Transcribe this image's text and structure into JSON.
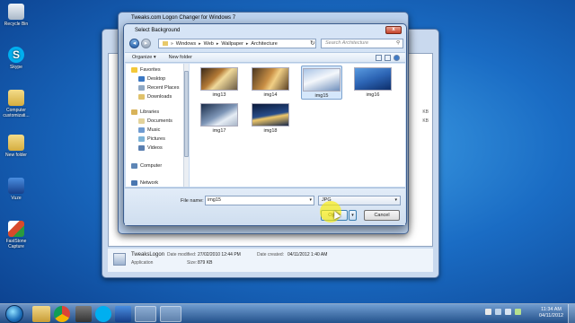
{
  "desktop": {
    "icons": [
      {
        "label": "Recycle Bin",
        "icon": "recycle-bin-icon",
        "color": "#cfd8e2"
      },
      {
        "label": "Skype",
        "icon": "skype-icon",
        "color": "#00aff0"
      },
      {
        "label": "Computer customizati...",
        "icon": "folder-icon",
        "color": "#e8c96a"
      },
      {
        "label": "New folder",
        "icon": "folder-icon",
        "color": "#e8c96a"
      },
      {
        "label": "Vuze",
        "icon": "vuze-icon",
        "color": "#1f5fb8"
      },
      {
        "label": "FastStone Capture",
        "icon": "faststone-icon",
        "color": "#d84a2b"
      }
    ]
  },
  "background_window": {
    "file_name": "TweaksLogon",
    "type": "Application",
    "date_modified_label": "Date modified:",
    "date_modified": "27/02/2010 12:44 PM",
    "size_label": "Size:",
    "size": "879 KB",
    "date_created_label": "Date created:",
    "date_created": "04/11/2012 1:40 AM",
    "sizes_col": [
      "KB",
      "KB"
    ]
  },
  "logon_changer": {
    "title": "Tweaks.com Logon Changer for Windows 7"
  },
  "dialog": {
    "title": "Select Background",
    "close": "x",
    "breadcrumb": [
      "Windows",
      "Web",
      "Wallpaper",
      "Architecture"
    ],
    "search_placeholder": "Search Architecture",
    "toolbar": {
      "organize": "Organize ▾",
      "new_folder": "New folder"
    },
    "nav": {
      "favorites": "Favorites",
      "favorites_items": [
        "Desktop",
        "Recent Places",
        "Downloads"
      ],
      "libraries": "Libraries",
      "libraries_items": [
        "Documents",
        "Music",
        "Pictures",
        "Videos"
      ],
      "computer": "Computer",
      "network": "Network"
    },
    "thumbnails": [
      {
        "label": "img13",
        "selected": false
      },
      {
        "label": "img14",
        "selected": false
      },
      {
        "label": "img15",
        "selected": true
      },
      {
        "label": "img16",
        "selected": false
      },
      {
        "label": "img17",
        "selected": false
      },
      {
        "label": "img18",
        "selected": false
      }
    ],
    "file_name_label": "File name:",
    "file_name_value": "img15",
    "filter_value": "JPG",
    "open_label": "Open",
    "cancel_label": "Cancel"
  },
  "taskbar": {
    "time": "11:34 AM",
    "date": "04/11/2012"
  }
}
